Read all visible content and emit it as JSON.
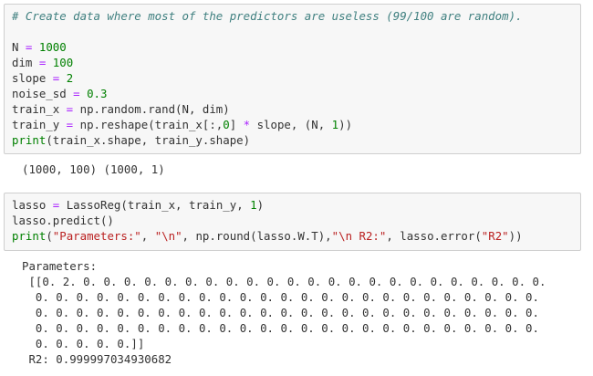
{
  "cell1": {
    "comment": "# Create data where most of the predictors are useless (99/100 are random).",
    "lines": [
      {
        "name": "N",
        "op": " = ",
        "value": "1000"
      },
      {
        "name": "dim",
        "op": " = ",
        "value": "100"
      },
      {
        "name": "slope",
        "op": " = ",
        "value": "2"
      },
      {
        "name": "noise_sd",
        "op": " = ",
        "value": "0.3"
      }
    ],
    "train_x_lhs": "train_x",
    "train_x_op": " = ",
    "train_x_rhs": "np.random.rand(N, dim)",
    "train_y_lhs": "train_y",
    "train_y_op": " = ",
    "train_y_rhs_a": "np.reshape(train_x[:,",
    "train_y_idx": "0",
    "train_y_rhs_b": "] ",
    "train_y_mul": "*",
    "train_y_rhs_c": " slope, (N, ",
    "train_y_one": "1",
    "train_y_rhs_d": "))",
    "print_kw": "print",
    "print_args": "(train_x.shape, train_y.shape)"
  },
  "out1": {
    "text": "(1000, 100) (1000, 1)"
  },
  "cell2": {
    "lasso_lhs": "lasso",
    "lasso_op": " = ",
    "lasso_rhs_a": "LassoReg(train_x, train_y, ",
    "lasso_one": "1",
    "lasso_rhs_b": ")",
    "predict_line": "lasso.predict()",
    "print_kw": "print",
    "paren_open": "(",
    "str1": "\"Parameters:\"",
    "sep1": ", ",
    "str2": "\"\\n\"",
    "mid": ", np.round(lasso.W.T),",
    "str3": "\"\\n R2:\"",
    "mid2": ", lasso.error(",
    "str4": "\"R2\"",
    "paren_close": "))"
  },
  "out2": {
    "line1": "Parameters:",
    "line2": " [[0. 2. 0. 0. 0. 0. 0. 0. 0. 0. 0. 0. 0. 0. 0. 0. 0. 0. 0. 0. 0. 0. 0. 0. 0.",
    "line3": "  0. 0. 0. 0. 0. 0. 0. 0. 0. 0. 0. 0. 0. 0. 0. 0. 0. 0. 0. 0. 0. 0. 0. 0. 0.",
    "line4": "  0. 0. 0. 0. 0. 0. 0. 0. 0. 0. 0. 0. 0. 0. 0. 0. 0. 0. 0. 0. 0. 0. 0. 0. 0.",
    "line5": "  0. 0. 0. 0. 0. 0. 0. 0. 0. 0. 0. 0. 0. 0. 0. 0. 0. 0. 0. 0. 0. 0. 0. 0. 0.",
    "line6": "  0. 0. 0. 0. 0.]]",
    "line7": " R2: 0.999997034930682"
  }
}
